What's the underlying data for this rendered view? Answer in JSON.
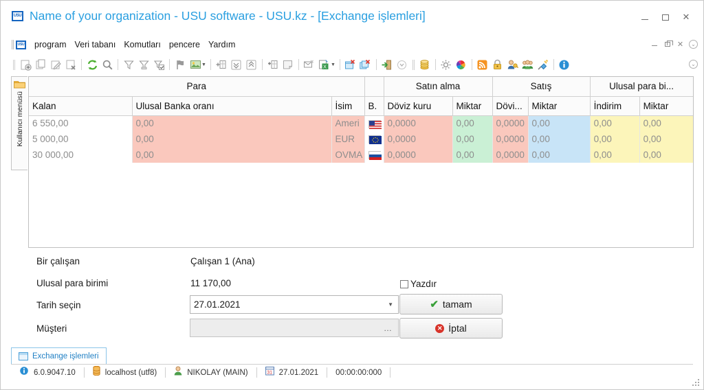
{
  "window": {
    "app_icon": "usu-logo-icon",
    "title": "Name of your organization - USU software - USU.kz - [Exchange işlemleri]",
    "controls": {
      "minimize": "minimize-icon",
      "maximize": "maximize-icon",
      "close": "×"
    }
  },
  "menubar": {
    "logo": "usu-logo-icon",
    "items": [
      {
        "label": "program"
      },
      {
        "label": "Veri tabanı"
      },
      {
        "label": "Komutları"
      },
      {
        "label": "pencere"
      },
      {
        "label": "Yardım"
      }
    ],
    "mdi_controls": {
      "minimize": "minimize-icon",
      "restore": "restore-icon",
      "close": "×",
      "more": "chevron-down-icon"
    }
  },
  "toolbar": {
    "groups": [
      {
        "items": [
          "add-record-icon",
          "copy-record-icon",
          "edit-record-icon",
          "delete-record-icon"
        ]
      },
      {
        "items": [
          "refresh-icon",
          "search-icon"
        ]
      },
      {
        "items": [
          "filter-icon",
          "filter-advanced-icon",
          "filter-check-icon"
        ]
      },
      {
        "items": [
          "flag-icon",
          "image-icon",
          "dropdown-caret"
        ]
      },
      {
        "items": [
          "group-panel-icon",
          "expand-all-icon",
          "collapse-all-icon"
        ]
      },
      {
        "items": [
          "add-column-icon",
          "note-icon"
        ]
      },
      {
        "items": [
          "mail-icon",
          "export-excel-icon",
          "dropdown-caret"
        ]
      },
      {
        "items": [
          "close-tab-icon",
          "close-all-tabs-icon"
        ]
      },
      {
        "items": [
          "exit-icon",
          "exit-more-icon"
        ]
      },
      {
        "items": [
          "coins-icon"
        ]
      },
      {
        "items": [
          "settings-gear-icon",
          "color-wheel-icon"
        ]
      },
      {
        "items": [
          "rss-icon",
          "lock-icon",
          "user-key-icon",
          "users-icon",
          "plug-icon"
        ]
      },
      {
        "items": [
          "info-icon"
        ]
      }
    ],
    "overflow": "chevron-down-icon"
  },
  "left_tab": {
    "icon": "folder-icon",
    "label": "Kullanıcı menüsü"
  },
  "grid": {
    "group_headers": [
      {
        "label": "Para",
        "span": 3
      },
      {
        "label": "",
        "span": 1
      },
      {
        "label": "Satın alma",
        "span": 2
      },
      {
        "label": "Satış",
        "span": 2
      },
      {
        "label": "Ulusal para bi...",
        "span": 2
      }
    ],
    "columns": [
      {
        "label": "Kalan",
        "tint": "white"
      },
      {
        "label": "Ulusal Banka oranı",
        "tint": "pink"
      },
      {
        "label": "İsim",
        "tint": "pink"
      },
      {
        "label": "B.",
        "tint": "flag"
      },
      {
        "label": "Döviz kuru",
        "tint": "pink"
      },
      {
        "label": "Miktar",
        "tint": "green"
      },
      {
        "label": "Dövi...",
        "tint": "pink"
      },
      {
        "label": "Miktar",
        "tint": "blue"
      },
      {
        "label": "İndirim",
        "tint": "yellow"
      },
      {
        "label": "Miktar",
        "tint": "yellow"
      }
    ],
    "rows": [
      {
        "kalan": "6 550,00",
        "ulusal_banka_orani": "0,00",
        "isim": "Ameri",
        "flag": "flag-usa",
        "satin_alma_doviz_kuru": "0,0000",
        "satin_alma_miktar": "0,00",
        "satis_doviz_kuru": "0,0000",
        "satis_miktar": "0,00",
        "indirim": "0,00",
        "ulusal_miktar": "0,00"
      },
      {
        "kalan": "5 000,00",
        "ulusal_banka_orani": "0,00",
        "isim": "EUR",
        "flag": "flag-eu",
        "satin_alma_doviz_kuru": "0,0000",
        "satin_alma_miktar": "0,00",
        "satis_doviz_kuru": "0,0000",
        "satis_miktar": "0,00",
        "indirim": "0,00",
        "ulusal_miktar": "0,00"
      },
      {
        "kalan": "30 000,00",
        "ulusal_banka_orani": "0,00",
        "isim": "OVMA",
        "flag": "flag-russia",
        "satin_alma_doviz_kuru": "0,0000",
        "satin_alma_miktar": "0,00",
        "satis_doviz_kuru": "0,0000",
        "satis_miktar": "0,00",
        "indirim": "0,00",
        "ulusal_miktar": "0,00"
      }
    ]
  },
  "form": {
    "employee_label": "Bir çalışan",
    "employee_value": "Çalışan 1 (Ana)",
    "currency_label": "Ulusal para birimi",
    "currency_value": "11 170,00",
    "date_label": "Tarih seçin",
    "date_value": "27.01.2021",
    "customer_label": "Müşteri",
    "customer_value": "",
    "print_checkbox_label": "Yazdır",
    "print_checked": false,
    "ok_button": "tamam",
    "cancel_button": "İptal"
  },
  "task_tab": {
    "icon": "window-icon",
    "label": "Exchange işlemleri"
  },
  "statusbar": {
    "version_icon": "info-icon",
    "version": "6.0.9047.10",
    "db_icon": "database-icon",
    "db": "localhost (utf8)",
    "user_icon": "user-icon",
    "user": "NIKOLAY (MAIN)",
    "date_icon": "calendar-icon",
    "date": "27.01.2021",
    "time": "00:00:00:000",
    "resize_grip": "resize-grip-icon"
  },
  "colors": {
    "title": "#2a9fe0",
    "pink": "#fac8bd",
    "green": "#caf0d5",
    "blue": "#c8e4f7",
    "yellow": "#fcf5ba",
    "link": "#1f7fc4"
  }
}
